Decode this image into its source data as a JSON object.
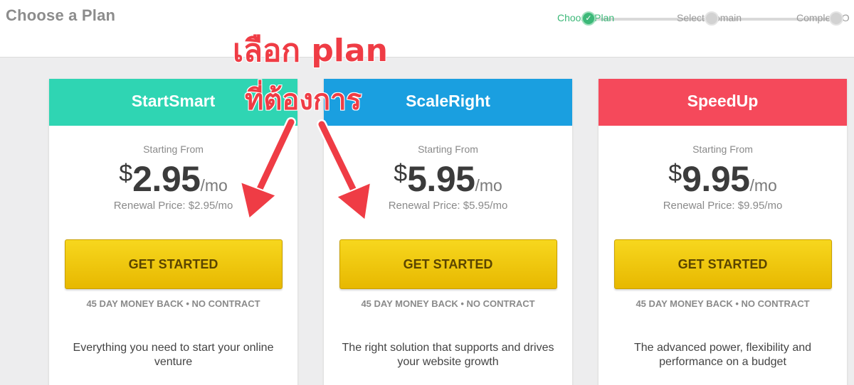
{
  "header": {
    "title": "Choose a Plan",
    "steps": [
      {
        "label": "Choose Plan",
        "state": "done"
      },
      {
        "label": "Select Domain",
        "state": "pending"
      },
      {
        "label": "Complete O",
        "state": "pending"
      }
    ]
  },
  "annotation": {
    "line1": "เลือก plan",
    "line2": "ที่ต้องการ",
    "color": "#ef3c45"
  },
  "plans": [
    {
      "name": "StartSmart",
      "color": "#2fd5b3",
      "starting_label": "Starting From",
      "currency": "$",
      "price": "2.95",
      "per": "/mo",
      "renewal": "Renewal Price: $2.95/mo",
      "cta": "GET STARTED",
      "guarantee": "45 DAY MONEY BACK • NO CONTRACT",
      "description": "Everything you need to start your online venture"
    },
    {
      "name": "ScaleRight",
      "color": "#1a9fe0",
      "starting_label": "Starting From",
      "currency": "$",
      "price": "5.95",
      "per": "/mo",
      "renewal": "Renewal Price: $5.95/mo",
      "cta": "GET STARTED",
      "guarantee": "45 DAY MONEY BACK • NO CONTRACT",
      "description": "The right solution that supports and drives your website growth"
    },
    {
      "name": "SpeedUp",
      "color": "#f5495b",
      "starting_label": "Starting From",
      "currency": "$",
      "price": "9.95",
      "per": "/mo",
      "renewal": "Renewal Price: $9.95/mo",
      "cta": "GET STARTED",
      "guarantee": "45 DAY MONEY BACK • NO CONTRACT",
      "description": "The advanced power, flexibility and performance on a budget"
    }
  ]
}
